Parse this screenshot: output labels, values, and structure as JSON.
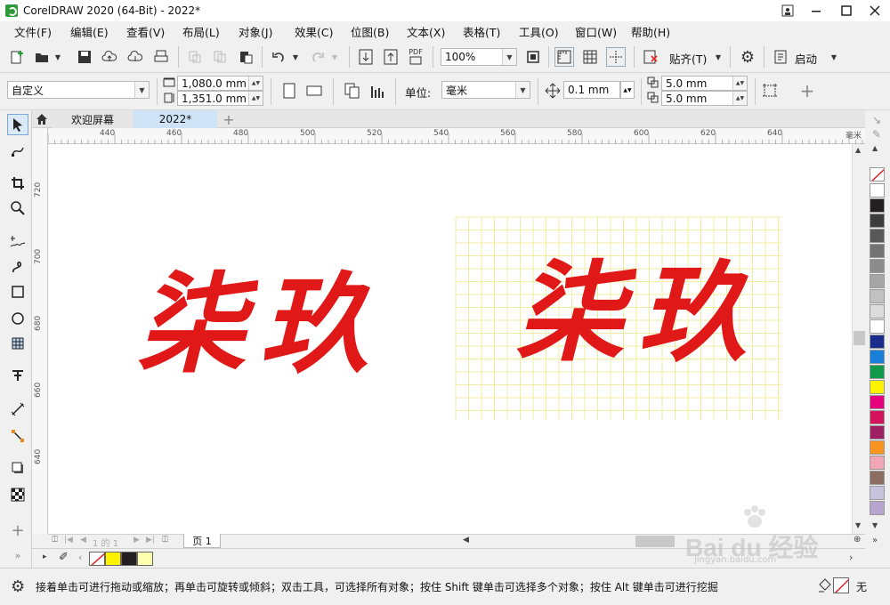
{
  "window": {
    "title": "CorelDRAW 2020 (64-Bit) - 2022*"
  },
  "menu": [
    "文件(F)",
    "编辑(E)",
    "查看(V)",
    "布局(L)",
    "对象(J)",
    "效果(C)",
    "位图(B)",
    "文本(X)",
    "表格(T)",
    "工具(O)",
    "窗口(W)",
    "帮助(H)"
  ],
  "toolbar": {
    "zoom_value": "100%",
    "snap_label": "贴齐(T)",
    "launch_label": "启动",
    "pdf_label": "PDF"
  },
  "propertybar": {
    "page_size": "自定义",
    "width": "1,080.0 mm",
    "height": "1,351.0 mm",
    "units_label": "单位:",
    "units_value": "毫米",
    "nudge": "0.1 mm",
    "dup_x": "5.0 mm",
    "dup_y": "5.0 mm"
  },
  "tabs": {
    "welcome": "欢迎屏幕",
    "doc": "2022*"
  },
  "ruler": {
    "h_unit": "毫米",
    "h_labels": [
      "440",
      "460",
      "480",
      "500",
      "520",
      "540",
      "560",
      "580",
      "600",
      "620",
      "640"
    ],
    "v_labels": [
      "720",
      "700",
      "680",
      "660",
      "640"
    ]
  },
  "artwork": {
    "text": "柒玖",
    "color": "#e01818",
    "grid_color": "#f1eda0"
  },
  "pagenav": {
    "counter": "1 的 1",
    "page_tab": "页 1"
  },
  "status": {
    "hint": "接着单击可进行拖动或缩放；再单击可旋转或倾斜；双击工具，可选择所有对象；按住 Shift 键单击可选择多个对象；按住 Alt 键单击可进行挖掘",
    "fill_none": "无"
  },
  "palette_colors": [
    "#ffffff",
    "#231f20",
    "#3d3d3d",
    "#585858",
    "#737373",
    "#8c8c8c",
    "#a6a6a6",
    "#c1c1c1",
    "#dcdcdc",
    "#ffffff",
    "#1a2d8c",
    "#1a7fd9",
    "#0e9a4a",
    "#fff200",
    "#e6007e",
    "#d4145a",
    "#9e1f63",
    "#f7941d",
    "#f2a8b4",
    "#8c6d62",
    "#c7c2dd",
    "#b6a6cf"
  ],
  "colorbar_swatches": [
    "#fff200",
    "#231f20",
    "#ffffb0"
  ],
  "watermark": {
    "brand": "Bai du 经验",
    "url": "jingyan.baidu.com"
  }
}
